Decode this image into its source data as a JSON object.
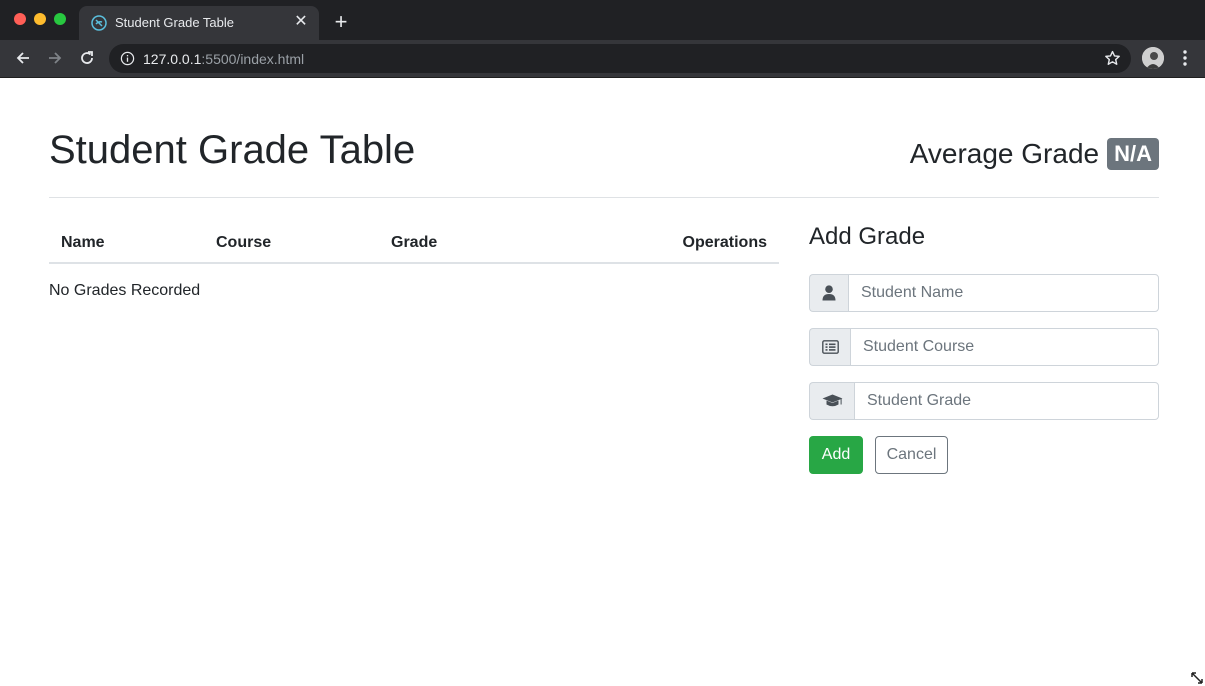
{
  "browser": {
    "tab_title": "Student Grade Table",
    "new_tab_symbol": "+",
    "close_symbol": "✕",
    "url_host": "127.0.0.1",
    "url_path": ":5500/index.html"
  },
  "header": {
    "title": "Student Grade Table",
    "average_label": "Average Grade",
    "average_value": "N/A"
  },
  "table": {
    "columns": [
      "Name",
      "Course",
      "Grade",
      "Operations"
    ],
    "empty_message": "No Grades Recorded"
  },
  "form": {
    "title": "Add Grade",
    "name_placeholder": "Student Name",
    "course_placeholder": "Student Course",
    "grade_placeholder": "Student Grade",
    "name_icon": "user-icon",
    "course_icon": "list-icon",
    "grade_icon": "graduation-cap-icon",
    "add_label": "Add",
    "cancel_label": "Cancel"
  },
  "colors": {
    "add_button": "#28a745",
    "badge": "#6c757d",
    "chrome_dark": "#202124"
  }
}
